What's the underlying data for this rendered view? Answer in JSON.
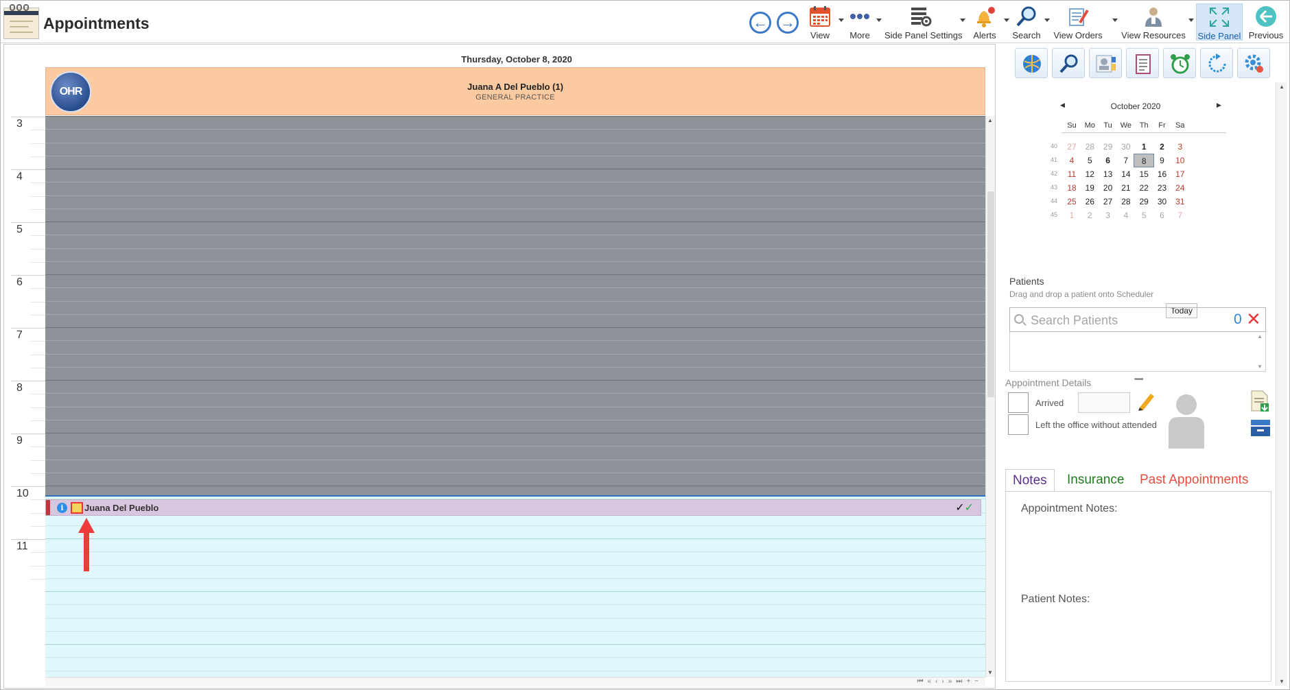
{
  "window": {
    "title": "Appointments"
  },
  "toolbar": {
    "view": "View",
    "more": "More",
    "side_panel_settings": "Side Panel Settings",
    "alerts": "Alerts",
    "search": "Search",
    "view_orders": "View Orders",
    "view_resources": "View Resources",
    "side_panel": "Side Panel",
    "previous": "Previous"
  },
  "scheduler": {
    "date": "Thursday, October 8, 2020",
    "resource": {
      "name": "Juana A Del Pueblo (1)",
      "specialty": "GENERAL PRACTICE",
      "logo_text": "OHR"
    },
    "hours": [
      "3",
      "4",
      "5",
      "6",
      "7",
      "8",
      "9",
      "10",
      "11"
    ],
    "appointment": {
      "patient": "Juana Del Pueblo",
      "info_glyph": "i"
    }
  },
  "calendar": {
    "month": "October 2020",
    "weekdays": [
      "Su",
      "Mo",
      "Tu",
      "We",
      "Th",
      "Fr",
      "Sa"
    ],
    "week_numbers": [
      "40",
      "41",
      "42",
      "43",
      "44",
      "45"
    ],
    "weeks": [
      [
        "27",
        "28",
        "29",
        "30",
        "1",
        "2",
        "3"
      ],
      [
        "4",
        "5",
        "6",
        "7",
        "8",
        "9",
        "10"
      ],
      [
        "11",
        "12",
        "13",
        "14",
        "15",
        "16",
        "17"
      ],
      [
        "18",
        "19",
        "20",
        "21",
        "22",
        "23",
        "24"
      ],
      [
        "25",
        "26",
        "27",
        "28",
        "29",
        "30",
        "31"
      ],
      [
        "1",
        "2",
        "3",
        "4",
        "5",
        "6",
        "7"
      ]
    ],
    "selected_day": "8",
    "today_label": "Today"
  },
  "patients": {
    "title": "Patients",
    "hint": "Drag and drop a patient onto Scheduler",
    "search_placeholder": "Search Patients",
    "count": "0",
    "clear_glyph": "✕"
  },
  "appointment_details": {
    "title": "Appointment Details",
    "arrived_label": "Arrived",
    "left_label": "Left the office without attended"
  },
  "tabs": {
    "notes": "Notes",
    "insurance": "Insurance",
    "past": "Past Appointments",
    "appointment_notes_label": "Appointment Notes:",
    "patient_notes_label": "Patient Notes:"
  },
  "colors": {
    "resource_header": "#fbcaa1",
    "off_hours": "#8e9299",
    "working_hours": "#e0f7fc",
    "appointment": "#d7c6de",
    "accent": "#2f6ebb"
  }
}
